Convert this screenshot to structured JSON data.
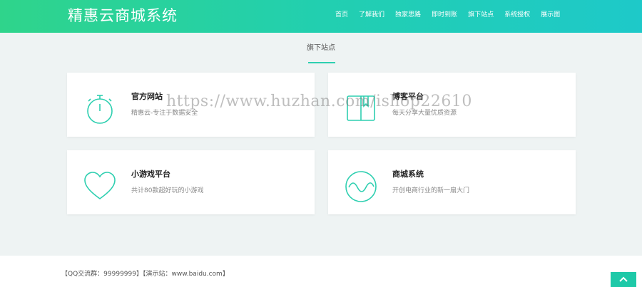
{
  "header": {
    "brand": "精惠云商城系统",
    "nav": [
      "首页",
      "了解我们",
      "独家思路",
      "即时到账",
      "旗下站点",
      "系统授权",
      "展示图"
    ]
  },
  "section": {
    "title": "旗下站点"
  },
  "cards": [
    {
      "title": "官方网站",
      "desc": "精惠云-专注于数据安全",
      "icon": "stopwatch-icon"
    },
    {
      "title": "博客平台",
      "desc": "每天分享大量优质资源",
      "icon": "book-icon"
    },
    {
      "title": "小游戏平台",
      "desc": "共计80款超好玩的小游戏",
      "icon": "heart-icon"
    },
    {
      "title": "商城系统",
      "desc": "开创电商行业的新一扇大门",
      "icon": "wave-circle-icon"
    }
  ],
  "footer": {
    "text": "【QQ交流群：99999999】【演示站：www.baidu.com】"
  },
  "watermark": "https://www.huzhan.com/ishop22610",
  "colors": {
    "accent": "#2ecfb0",
    "header_start": "#2fd48b",
    "header_end": "#1ec9c9"
  }
}
